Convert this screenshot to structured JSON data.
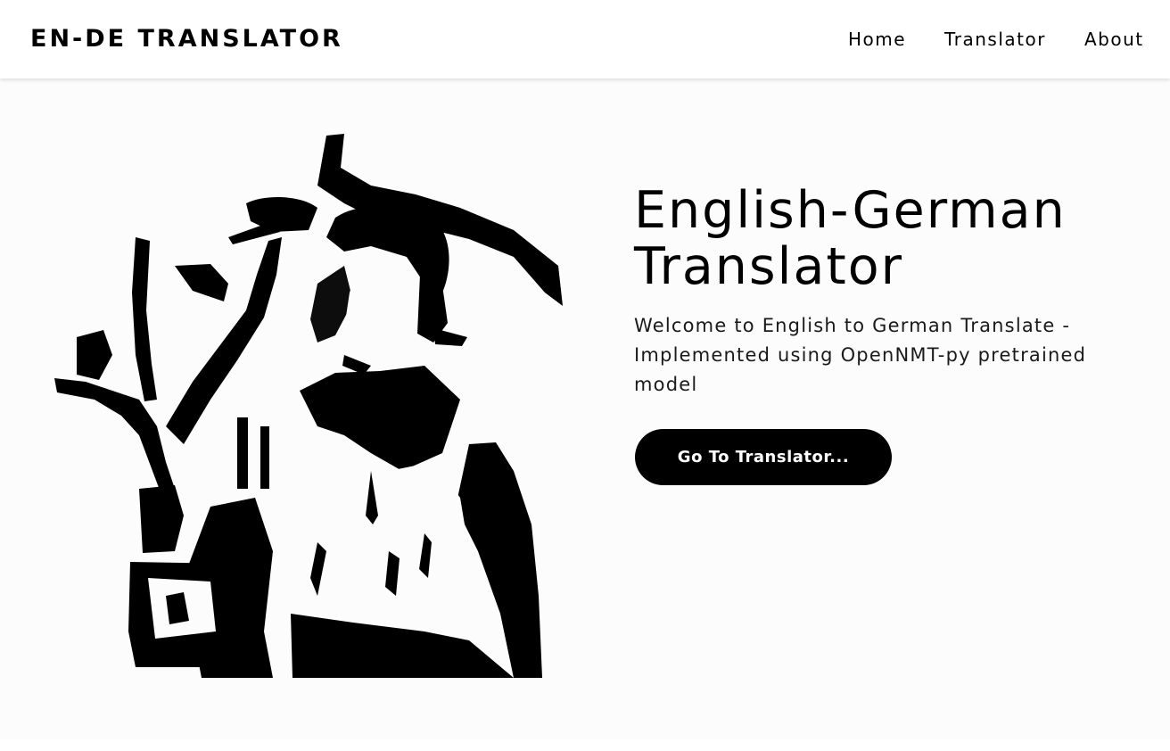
{
  "navbar": {
    "brand": "EN-DE TRANSLATOR",
    "links": [
      {
        "label": "Home"
      },
      {
        "label": "Translator"
      },
      {
        "label": "About"
      }
    ]
  },
  "hero": {
    "title_line1": "English-German",
    "title_line2": "Translator",
    "subtitle": "Welcome to English to German Translate - Implemented using OpenNMT-py pretrained model",
    "cta_label": "Go To Translator..."
  },
  "colors": {
    "accent": "#000000",
    "background": "#fcfcfc",
    "navbar_bg": "#ffffff"
  }
}
